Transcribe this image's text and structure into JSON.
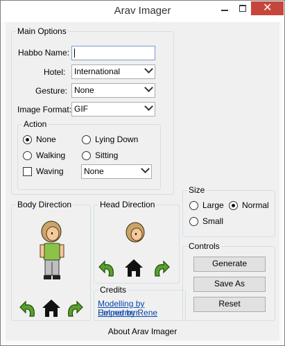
{
  "window": {
    "title": "Arav Imager",
    "close_glyph": "✕"
  },
  "main_options": {
    "title": "Main Options",
    "habbo_name_label": "Habbo Name:",
    "habbo_name_value": "",
    "hotel_label": "Hotel:",
    "hotel_value": "International",
    "gesture_label": "Gesture:",
    "gesture_value": "None",
    "format_label": "Image Format:",
    "format_value": "GIF"
  },
  "action": {
    "title": "Action",
    "none": "None",
    "walking": "Walking",
    "lying": "Lying Down",
    "sitting": "Sitting",
    "waving": "Waving",
    "hand_value": "None",
    "selected": "None",
    "waving_checked": false
  },
  "size": {
    "title": "Size",
    "large": "Large",
    "normal": "Normal",
    "small": "Small",
    "selected": "Normal"
  },
  "controls": {
    "title": "Controls",
    "generate": "Generate",
    "save_as": "Save As",
    "reset": "Reset"
  },
  "body_direction": {
    "title": "Body Direction"
  },
  "head_direction": {
    "title": "Head Direction"
  },
  "credits": {
    "title": "Credits",
    "line1": "Modelling by Emmerrrrrr.",
    "line2": "Helped by Rene"
  },
  "about": "About Arav Imager",
  "icons": [
    "rotate-left-icon",
    "home-icon",
    "rotate-right-icon"
  ],
  "colors": {
    "close": "#c7463c",
    "link": "#0645ad",
    "rotate_arrow": "#3a7d1a"
  }
}
